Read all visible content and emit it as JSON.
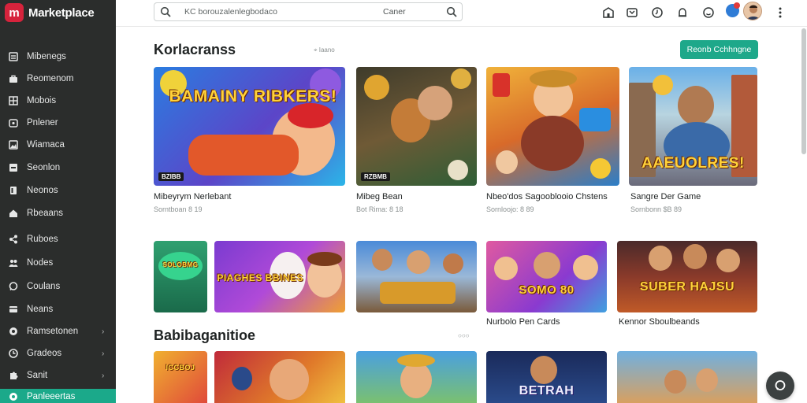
{
  "brand": {
    "name": "Marketplace",
    "logo_letter": "m",
    "logo_color": "#d6233c"
  },
  "sidebar": {
    "accent": "#1ba98a",
    "items": [
      {
        "label": "Mibenegs",
        "icon": "dashboard-icon"
      },
      {
        "label": "Reomenom",
        "icon": "bag-icon"
      },
      {
        "label": "Mobois",
        "icon": "grid-icon"
      },
      {
        "label": "Pnlener",
        "icon": "calendar-icon"
      },
      {
        "label": "Wiamaca",
        "icon": "gallery-icon"
      },
      {
        "label": "Seonlon",
        "icon": "tag-icon"
      },
      {
        "label": "Neonos",
        "icon": "book-icon"
      },
      {
        "label": "Rbeaans",
        "icon": "home-icon"
      },
      {
        "label": "Ruboes",
        "icon": "share-icon"
      },
      {
        "label": "Nodes",
        "icon": "people-icon"
      },
      {
        "label": "Coulans",
        "icon": "chat-icon"
      },
      {
        "label": "Neans",
        "icon": "card-icon"
      },
      {
        "label": "Ramsetonen",
        "icon": "circle-icon",
        "chevron": "›"
      },
      {
        "label": "Gradeos",
        "icon": "clock-icon",
        "chevron": "›"
      },
      {
        "label": "Sanit",
        "icon": "puzzle-icon",
        "chevron": "›"
      },
      {
        "label": "Panleeertas",
        "icon": "sparkle-icon",
        "active": true
      }
    ]
  },
  "search": {
    "placeholder": "KC borouzalenlegbodaco",
    "scope": "Caner"
  },
  "topbar": {
    "icons": [
      "store-icon",
      "wallet-icon",
      "history-icon",
      "bell-icon",
      "smile-icon",
      "notification-icon",
      "avatar",
      "more-vert-icon"
    ]
  },
  "sections": [
    {
      "title": "Korlacranss",
      "meta": "⌖ Iaano"
    },
    {
      "title": "Babibaganitioe",
      "meta": "○○○"
    }
  ],
  "cta_label": "Reonb Cchhngne",
  "row1": [
    {
      "title": "Mibeyrym Nerlebant",
      "sub": "Sorntboan 8 19",
      "art": "BAMAINY RIBKERS!",
      "tag": "BZIBB"
    },
    {
      "title": "Mibeg Bean",
      "sub": "Bot Rima: 8 18",
      "art": "",
      "tag": "RZBMB"
    },
    {
      "title": "Nbeo'dos Sagooblooio Chstens",
      "sub": "Sornloojo: 8 89",
      "art": "",
      "tag": ""
    },
    {
      "title": "Sangre Der Game",
      "sub": "Sornbonn $B 89",
      "art": "AAEUOLRES!",
      "tag": ""
    }
  ],
  "row2": [
    {
      "title": "",
      "art": "SOLOBMG"
    },
    {
      "title": "",
      "art": "PIAGHES BBINES"
    },
    {
      "title": "",
      "art": ""
    },
    {
      "title": "Nurbolo Pen Cards",
      "art": "SOMO 80"
    },
    {
      "title": "Kennor Sboulbeands",
      "art": "SUBER HAJSU"
    }
  ],
  "row3": [
    {
      "art": "ICCBOJ"
    },
    {
      "art": ""
    },
    {
      "art": ""
    },
    {
      "art": "BETRAH"
    },
    {
      "art": ""
    }
  ]
}
